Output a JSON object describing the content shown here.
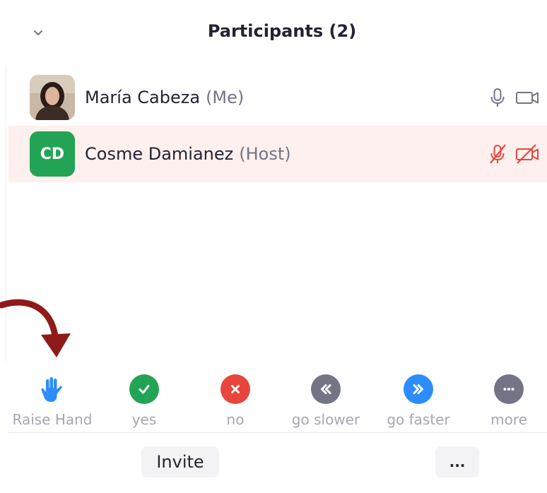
{
  "header": {
    "title": "Participants (2)"
  },
  "participants": [
    {
      "name": "María Cabeza",
      "role": "(Me)",
      "avatar": "photo",
      "mic": "mic-icon",
      "video": "video-icon"
    },
    {
      "name": "Cosme Damianez",
      "role": "(Host)",
      "initials": "CD",
      "avatar_color": "#23a455",
      "mic": "mic-muted-icon",
      "video": "video-off-icon",
      "row_highlight": "#fdf0ee"
    }
  ],
  "reactions": [
    {
      "label": "Raise Hand",
      "icon": "raise-hand-icon",
      "color": "#2d8cff"
    },
    {
      "label": "yes",
      "icon": "check-icon",
      "color": "#23a455"
    },
    {
      "label": "no",
      "icon": "x-icon",
      "color": "#e8453c"
    },
    {
      "label": "go slower",
      "icon": "rewind-icon",
      "color": "#747487"
    },
    {
      "label": "go faster",
      "icon": "fast-forward-icon",
      "color": "#2d8cff"
    },
    {
      "label": "more",
      "icon": "ellipsis-icon",
      "color": "#747487"
    }
  ],
  "footer": {
    "invite_label": "Invite",
    "more_label": "..."
  },
  "colors": {
    "muted_red": "#e8453c",
    "arrow": "#8e1a1a"
  }
}
